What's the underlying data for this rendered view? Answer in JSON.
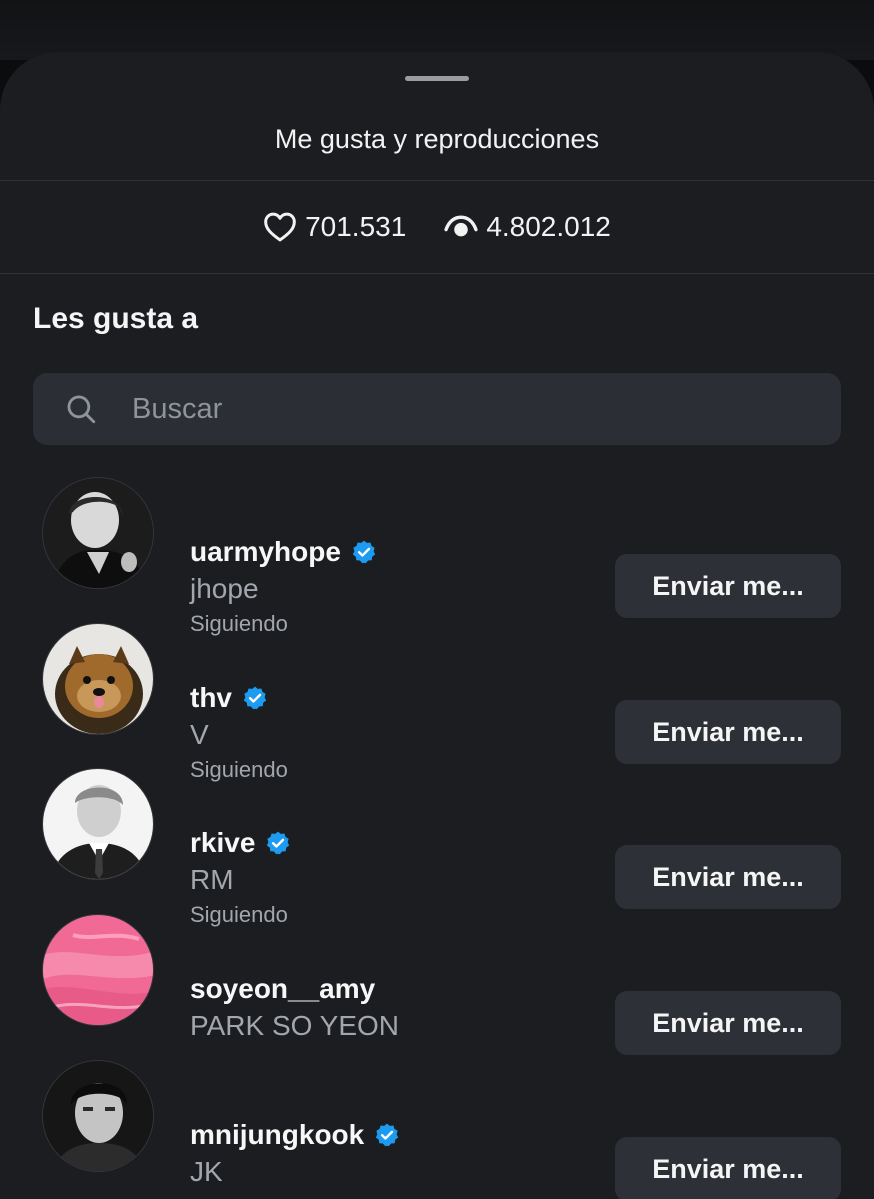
{
  "sheet": {
    "title": "Me gusta y reproducciones"
  },
  "stats": {
    "likes": "701.531",
    "views": "4.802.012",
    "likes_icon": "heart-icon",
    "views_icon": "eye-icon"
  },
  "section": {
    "title": "Les gusta a"
  },
  "search": {
    "placeholder": "Buscar",
    "value": ""
  },
  "users": [
    {
      "username": "uarmyhope",
      "display_name": "jhope",
      "status": "Siguiendo",
      "verified": true,
      "button_label": "Enviar me..."
    },
    {
      "username": "thv",
      "display_name": "V",
      "status": "Siguiendo",
      "verified": true,
      "button_label": "Enviar me..."
    },
    {
      "username": "rkive",
      "display_name": "RM",
      "status": "Siguiendo",
      "verified": true,
      "button_label": "Enviar me..."
    },
    {
      "username": "soyeon__amy",
      "display_name": "PARK SO YEON",
      "status": "",
      "verified": false,
      "button_label": "Enviar me..."
    },
    {
      "username": "mnijungkook",
      "display_name": "JK",
      "status": "",
      "verified": true,
      "button_label": "Enviar me..."
    }
  ],
  "colors": {
    "sheet_background": "#1b1d20",
    "search_background": "#2b2e34",
    "button_background": "#2d3036",
    "verified_badge": "#1d9bf0",
    "secondary_text": "#a2a6ad"
  }
}
